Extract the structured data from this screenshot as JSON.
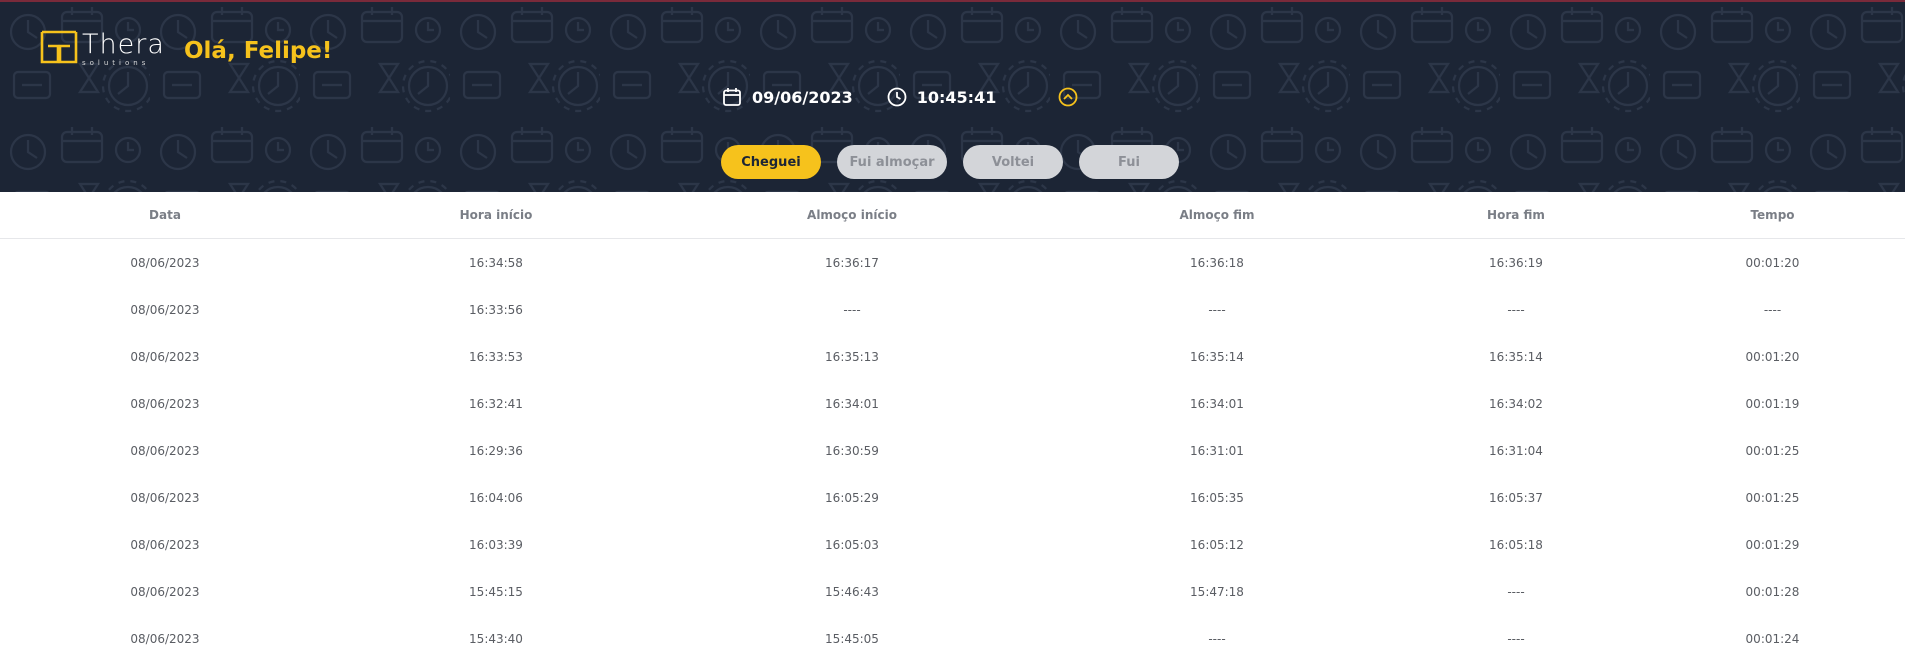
{
  "brand": {
    "name": "Thera",
    "tagline": "solutions",
    "accent_color": "#f6c21c",
    "header_bg": "#1c2535"
  },
  "greeting": "Olá, Felipe!",
  "clock": {
    "date": "09/06/2023",
    "time": "10:45:41",
    "date_icon": "calendar-icon",
    "time_icon": "clock-icon",
    "toggle_icon": "chevron-up-circle-icon"
  },
  "actions": {
    "arrived": "Cheguei",
    "lunch_start": "Fui almoçar",
    "lunch_end": "Voltei",
    "left": "Fui"
  },
  "table": {
    "headers": [
      "Data",
      "Hora início",
      "Almoço início",
      "Almoço fim",
      "Hora fim",
      "Tempo"
    ],
    "rows": [
      [
        "08/06/2023",
        "16:34:58",
        "16:36:17",
        "16:36:18",
        "16:36:19",
        "00:01:20"
      ],
      [
        "08/06/2023",
        "16:33:56",
        "----",
        "----",
        "----",
        "----"
      ],
      [
        "08/06/2023",
        "16:33:53",
        "16:35:13",
        "16:35:14",
        "16:35:14",
        "00:01:20"
      ],
      [
        "08/06/2023",
        "16:32:41",
        "16:34:01",
        "16:34:01",
        "16:34:02",
        "00:01:19"
      ],
      [
        "08/06/2023",
        "16:29:36",
        "16:30:59",
        "16:31:01",
        "16:31:04",
        "00:01:25"
      ],
      [
        "08/06/2023",
        "16:04:06",
        "16:05:29",
        "16:05:35",
        "16:05:37",
        "00:01:25"
      ],
      [
        "08/06/2023",
        "16:03:39",
        "16:05:03",
        "16:05:12",
        "16:05:18",
        "00:01:29"
      ],
      [
        "08/06/2023",
        "15:45:15",
        "15:46:43",
        "15:47:18",
        "----",
        "00:01:28"
      ],
      [
        "08/06/2023",
        "15:43:40",
        "15:45:05",
        "----",
        "----",
        "00:01:24"
      ]
    ]
  }
}
